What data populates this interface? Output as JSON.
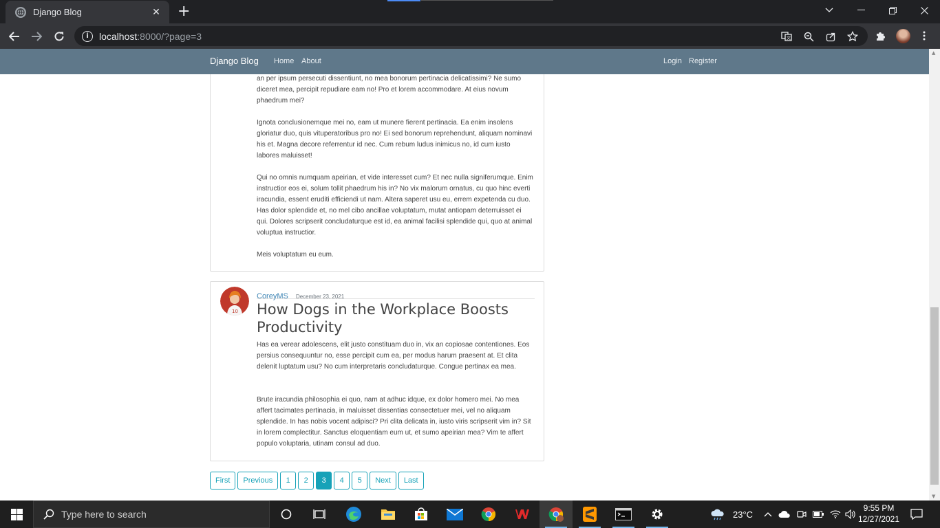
{
  "browser": {
    "tab_title": "Django Blog",
    "new_tab_symbol": "+",
    "close_symbol": "✕",
    "url_host": "localhost",
    "url_rest": ":8000/?page=3"
  },
  "site": {
    "brand": "Django Blog",
    "nav_left": [
      "Home",
      "About"
    ],
    "nav_right": [
      "Login",
      "Register"
    ]
  },
  "posts": [
    {
      "paragraphs": [
        "an per ipsum persecuti dissentiunt, no mea bonorum pertinacia delicatissimi? Ne sumo diceret mea, percipit repudiare eam no! Pro et lorem accommodare. At eius novum phaedrum mei?",
        "Ignota conclusionemque mei no, eam ut munere fierent pertinacia. Ea enim insolens gloriatur duo, quis vituperatoribus pro no! Ei sed bonorum reprehendunt, aliquam nominavi his et. Magna decore referrentur id nec. Cum rebum ludus inimicus no, id cum iusto labores maluisset!",
        "Qui no omnis numquam apeirian, et vide interesset cum? Et nec nulla signiferumque. Enim instructior eos ei, solum tollit phaedrum his in? No vix malorum ornatus, cu quo hinc everti iracundia, essent eruditi efficiendi ut nam. Altera saperet usu eu, errem expetenda cu duo. Has dolor splendide et, no mel cibo ancillae voluptatum, mutat antiopam deterruisset ei qui. Dolores scripserit concludaturque est id, ea animal facilisi splendide qui, quo at animal voluptua instructior.",
        "Meis voluptatum eu eum."
      ]
    },
    {
      "author": "CoreyMS",
      "date": "December 23, 2021",
      "title": "How Dogs in the Workplace Boosts Productivity",
      "paragraphs": [
        "Has ea verear adolescens, elit justo constituam duo in, vix an copiosae contentiones. Eos persius consequuntur no, esse percipit cum ea, per modus harum praesent at. Et clita delenit luptatum usu? No cum interpretaris concludaturque. Congue pertinax ea mea.",
        "Brute iracundia philosophia ei quo, nam at adhuc idque, ex dolor homero mei. No mea affert tacimates pertinacia, in maluisset dissentias consectetuer mei, vel no aliquam splendide. In has nobis vocent adipisci? Pri clita delicata in, iusto viris scripserit vim in? Sit in lorem complectitur. Sanctus eloquentiam eum ut, et sumo apeirian mea? Vim te affert populo voluptaria, utinam consul ad duo."
      ]
    }
  ],
  "pagination": {
    "first": "First",
    "previous": "Previous",
    "pages": [
      "1",
      "2",
      "3",
      "4",
      "5"
    ],
    "current": "3",
    "next": "Next",
    "last": "Last"
  },
  "taskbar": {
    "search_placeholder": "Type here to search",
    "temperature": "23°C",
    "time": "9:55 PM",
    "date": "12/27/2021"
  },
  "colors": {
    "navbar": "#5f788a",
    "link": "#3f86b5",
    "pagination": "#17a2b8"
  }
}
